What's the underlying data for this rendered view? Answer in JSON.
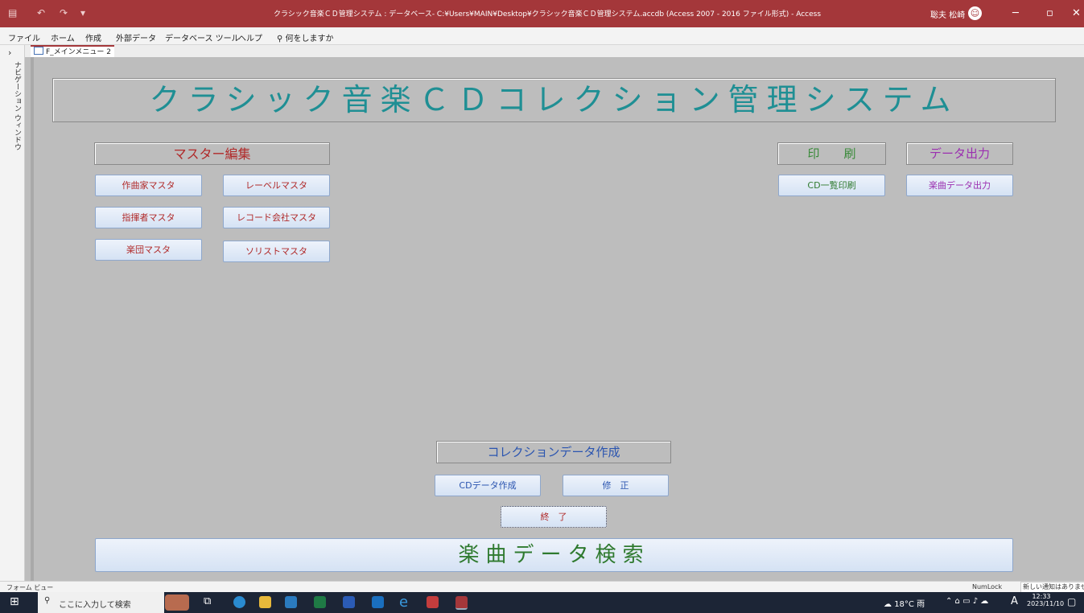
{
  "titlebar": {
    "title": "クラシック音楽ＣＤ管理システム : データベース- C:¥Users¥MAIN¥Desktop¥クラシック音楽ＣＤ管理システム.accdb (Access 2007 - 2016 ファイル形式) - Access",
    "user_name": "聡夫 松崎",
    "icons": [
      "save-icon",
      "undo-icon",
      "redo-icon",
      "customize-icon"
    ]
  },
  "ribbon": {
    "tabs": [
      "ファイル",
      "ホーム",
      "作成",
      "外部データ",
      "データベース ツール",
      "ヘルプ"
    ],
    "tell_me": "何をしますか"
  },
  "nav_pane": {
    "label": "ナビゲーション ウィンドウ"
  },
  "doc_tab": {
    "label": "F_メインメニュー 2"
  },
  "form": {
    "main_title": "クラシック音楽ＣＤコレクション管理システム",
    "master_header": "マスター編集",
    "master_buttons": [
      "作曲家マスタ",
      "レーベルマスタ",
      "指揮者マスタ",
      "レコード会社マスタ",
      "楽団マスタ",
      "ソリストマスタ"
    ],
    "print_header": "印　　刷",
    "print_button": "CD一覧印刷",
    "export_header": "データ出力",
    "export_button": "楽曲データ出力",
    "collection_header": "コレクションデータ作成",
    "create_button": "CDデータ作成",
    "edit_button": "修　正",
    "exit_button": "終　了",
    "search_button": "楽曲データ検索",
    "colors": {
      "title": "#1f8f94",
      "master": "#b02a2a",
      "print": "#3a8a3a",
      "export": "#9b2fb0",
      "collection": "#2b55b0"
    }
  },
  "statusbar": {
    "view": "フォーム ビュー",
    "numlock": "NumLock",
    "notify": "新しい通知はありません"
  },
  "taskbar": {
    "search": "ここに入力して検索",
    "weather": "18°C 雨",
    "ime": "A",
    "time": "12:33",
    "date": "2023/11/10"
  }
}
